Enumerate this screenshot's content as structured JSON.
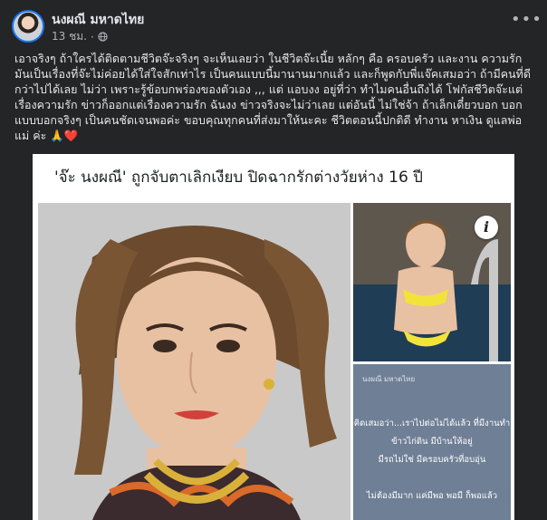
{
  "post": {
    "author": "นงผณี มหาดไทย",
    "time": "13 ชม.",
    "separator": "·",
    "privacy_icon": "globe-icon",
    "more_icon": "more-horizontal-icon",
    "more_label": "•••",
    "body": "เอาจริงๆ ถ้าใครได้ติดตามชีวิตจ๊ะจริงๆ จะเห็นเลยว่า ในชีวิตจ๊ะเนี้ย หลักๆ คือ ครอบครัว และงาน ความรักมันเป็นเรื่องที่จ๊ะไม่ค่อยได้ใส่ใจสักเท่าไร เป็นคนแบบนี้มานานมากแล้ว และก็พูดกับพี่แจ๊คเสมอว่า ถ้ามีคนที่ดีกว่าไปได้เลย ไม่ว่า เพราะรู้ข้อบกพร่องของตัวเอง ,,, แต่ แอบงง อยู่ที่ว่า ทำไมคนอื่นถึงได้ โฟกัสชีวิตจ๊ะแต่เรื่องความรัก ข่าวก็ออกแต่เรื่องความรัก ฉันงง ข่าวจริงจะไม่ว่าเลย แต่อันนี้ ไม่ใช่จ้า ถ้าเล็กเดี๋ยวบอก บอกแบบบอกจริงๆ เป็นคนชัดเจนพอค่ะ ขอบคุณทุกคนที่ส่งมาให้นะคะ ชีวิตตอนนี้ปกติดี ทำงาน หาเงิน ดูแลพ่อแม่ ค่ะ 🙏❤️"
  },
  "embed": {
    "headline": "'จ๊ะ นงผณี' ถูกจับตาเลิกเงียบ ปิดฉากรักต่างวัยห่าง 16 ปี",
    "info_label": "i",
    "info_icon": "info-icon",
    "screenshot": {
      "name": "นงผณี มหาดไทย",
      "lines": [
        "คิดเสมอว่า...เราไปต่อไม่ได้แล้ว ที่มีงานทำ",
        "ข้าวไก่ดิน มีบ้านให้อยู่",
        "มีรถไม่ใช่ มีครอบครัวที่อบอุ่น",
        "ไม่ต้องมีมาก แค่มีพอ พอมี ก็พอแล้ว"
      ]
    }
  },
  "colors": {
    "background": "#242526",
    "text_primary": "#e4e6eb",
    "text_secondary": "#b0b3b8",
    "accent": "#1877f2",
    "embed_background": "#ffffff"
  }
}
